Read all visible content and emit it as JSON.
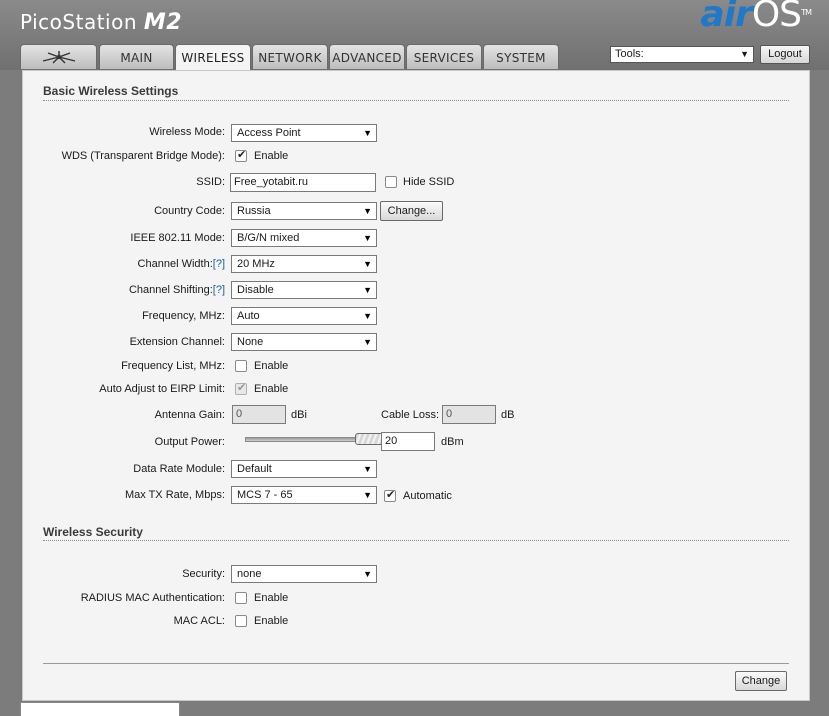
{
  "header": {
    "product_name": "PicoStation",
    "product_model": "M2",
    "brand_air": "air",
    "brand_os": "OS",
    "brand_tm": "TM"
  },
  "tabs": [
    {
      "label": "",
      "icon": "ubiquiti-logo-icon"
    },
    {
      "label": "MAIN"
    },
    {
      "label": "WIRELESS",
      "active": true
    },
    {
      "label": "NETWORK"
    },
    {
      "label": "ADVANCED"
    },
    {
      "label": "SERVICES"
    },
    {
      "label": "SYSTEM"
    }
  ],
  "tools": {
    "selected": "Tools:",
    "logout_label": "Logout"
  },
  "basic": {
    "title": "Basic Wireless Settings",
    "wireless_mode": {
      "label": "Wireless Mode:",
      "value": "Access Point"
    },
    "wds": {
      "label": "WDS (Transparent Bridge Mode):",
      "checkbox_label": "Enable",
      "checked": true
    },
    "ssid": {
      "label": "SSID:",
      "value": "Free_yotabit.ru",
      "hide_label": "Hide SSID",
      "hide_checked": false
    },
    "country": {
      "label": "Country Code:",
      "value": "Russia",
      "button": "Change..."
    },
    "ieee": {
      "label": "IEEE 802.11 Mode:",
      "value": "B/G/N mixed"
    },
    "channel_width": {
      "label": "Channel Width:",
      "help": "[?]",
      "value": "20 MHz"
    },
    "channel_shifting": {
      "label": "Channel Shifting:",
      "help": "[?]",
      "value": "Disable"
    },
    "frequency": {
      "label": "Frequency, MHz:",
      "value": "Auto"
    },
    "extension_channel": {
      "label": "Extension Channel:",
      "value": "None"
    },
    "frequency_list": {
      "label": "Frequency List, MHz:",
      "checkbox_label": "Enable",
      "checked": false
    },
    "auto_adjust": {
      "label": "Auto Adjust to EIRP Limit:",
      "checkbox_label": "Enable",
      "checked": true
    },
    "antenna_gain": {
      "label": "Antenna Gain:",
      "value": "0",
      "unit": "dBi"
    },
    "cable_loss": {
      "label": "Cable Loss:",
      "value": "0",
      "unit": "dB"
    },
    "output_power": {
      "label": "Output Power:",
      "value": "20",
      "unit": "dBm",
      "level": 1.0
    },
    "data_rate": {
      "label": "Data Rate Module:",
      "value": "Default"
    },
    "max_tx": {
      "label": "Max TX Rate, Mbps:",
      "value": "MCS 7 - 65",
      "auto_label": "Automatic",
      "auto_checked": true
    }
  },
  "security": {
    "title": "Wireless Security",
    "security": {
      "label": "Security:",
      "value": "none"
    },
    "radius": {
      "label": "RADIUS MAC Authentication:",
      "checkbox_label": "Enable",
      "checked": false
    },
    "mac_acl": {
      "label": "MAC ACL:",
      "checkbox_label": "Enable",
      "checked": false
    }
  },
  "footer": {
    "change_label": "Change"
  },
  "colors": {
    "accent": "#1f78c8",
    "help_link": "#1a5ea8",
    "header_bg": "#7c7c7c",
    "panel_bg": "#f4f4f4"
  }
}
